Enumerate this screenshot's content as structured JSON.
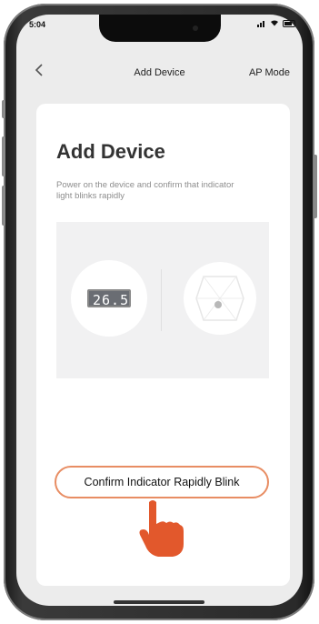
{
  "status_bar": {
    "time": "5:04"
  },
  "nav": {
    "back_icon": "chevron-left-icon",
    "title": "Add Device",
    "right_label": "AP Mode"
  },
  "content": {
    "title": "Add Device",
    "description": "Power on the device and confirm that indicator light blinks rapidly",
    "lcd_value": "26.5"
  },
  "confirm_button": {
    "label": "Confirm Indicator Rapidly Blink"
  },
  "colors": {
    "accent": "#e88d63",
    "hand": "#e2582c"
  }
}
